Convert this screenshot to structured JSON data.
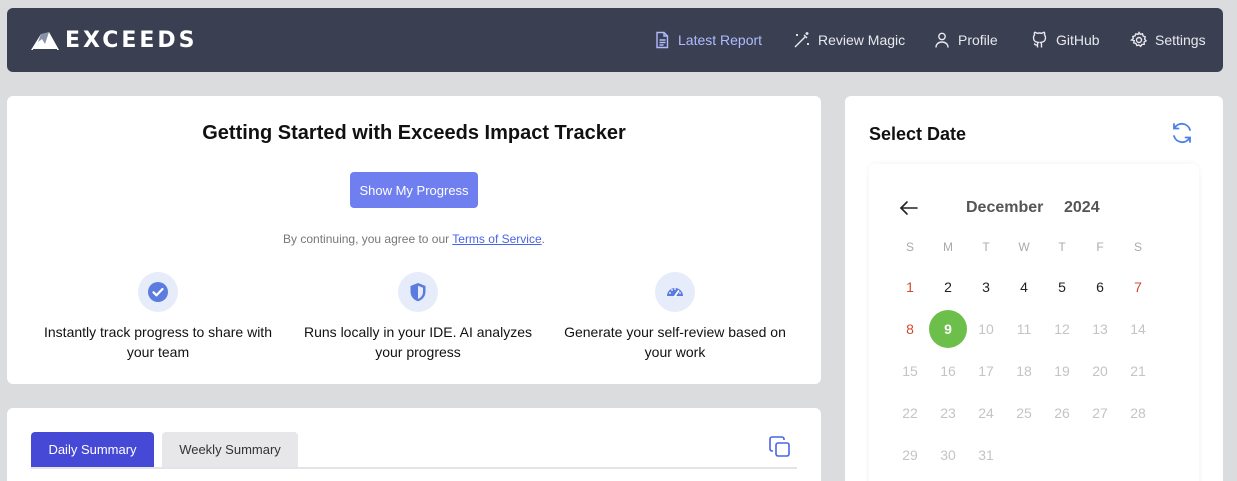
{
  "app": {
    "name": "EXCEEDS",
    "logo_icon": "mountain-logo-icon"
  },
  "nav": {
    "items": [
      {
        "label": "Latest Report",
        "icon": "document-icon",
        "active": true
      },
      {
        "label": "Review Magic",
        "icon": "magic-wand-icon"
      },
      {
        "label": "Profile",
        "icon": "user-icon"
      },
      {
        "label": "GitHub",
        "icon": "github-icon"
      },
      {
        "label": "Settings",
        "icon": "gear-icon"
      }
    ]
  },
  "getting_started": {
    "title": "Getting Started with Exceeds Impact Tracker",
    "button": "Show My Progress",
    "agree_prefix": "By continuing, you agree to our ",
    "agree_link": "Terms of Service",
    "agree_suffix": ".",
    "features": [
      {
        "icon": "check-circle-icon",
        "text": "Instantly track progress to share with your team"
      },
      {
        "icon": "shield-icon",
        "text": "Runs locally in your IDE. AI analyzes your progress"
      },
      {
        "icon": "speedometer-icon",
        "text": "Generate your self-review based on your work"
      }
    ]
  },
  "summary": {
    "tabs": [
      {
        "label": "Daily Summary",
        "active": true
      },
      {
        "label": "Weekly Summary"
      }
    ],
    "copy_icon": "copy-icon"
  },
  "date_picker": {
    "title": "Select Date",
    "month": "December",
    "year": "2024",
    "weekdays": [
      "S",
      "M",
      "T",
      "W",
      "T",
      "F",
      "S"
    ],
    "selected_day": "9",
    "weeks": [
      [
        "1",
        "2",
        "3",
        "4",
        "5",
        "6",
        "7"
      ],
      [
        "8",
        "9",
        "10",
        "11",
        "12",
        "13",
        "14"
      ],
      [
        "15",
        "16",
        "17",
        "18",
        "19",
        "20",
        "21"
      ],
      [
        "22",
        "23",
        "24",
        "25",
        "26",
        "27",
        "28"
      ],
      [
        "29",
        "30",
        "31"
      ]
    ]
  },
  "colors": {
    "topbar": "#3b3f52",
    "accent": "#4649d6",
    "button": "#6f7ff0",
    "selected_day": "#6cbf4b",
    "weekend": "#d14a2b"
  }
}
